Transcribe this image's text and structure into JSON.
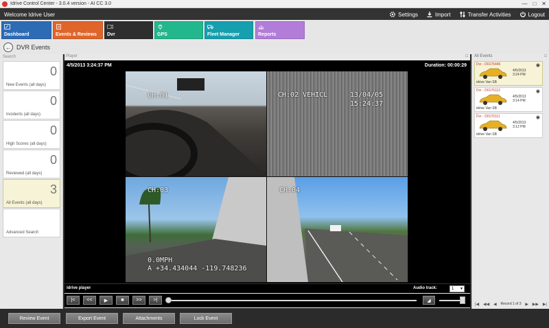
{
  "window": {
    "title": "Idrive Control Center - 3.0.4 version - AI CC 3.0"
  },
  "header": {
    "welcome": "Welcome Idrive User",
    "settings": "Settings",
    "import": "Import",
    "transfer": "Transfer Activities",
    "logout": "Logout"
  },
  "tabs": [
    {
      "label": "Dashboard",
      "color": "#2d6bb5"
    },
    {
      "label": "Events & Reviews",
      "color": "#e0652b"
    },
    {
      "label": "Dvr",
      "color": "#2e2e2e"
    },
    {
      "label": "GPS",
      "color": "#23b78e"
    },
    {
      "label": "Fleet Manager",
      "color": "#169fae"
    },
    {
      "label": "Reports",
      "color": "#b27cd9"
    }
  ],
  "page": {
    "title": "DVR Events"
  },
  "search": {
    "caption": "Search",
    "items": [
      {
        "value": "0",
        "label": "New Events (all days)"
      },
      {
        "value": "0",
        "label": "Incidents (all days)"
      },
      {
        "value": "0",
        "label": "High Scores (all days)"
      },
      {
        "value": "0",
        "label": "Reviewed (all days)"
      },
      {
        "value": "3",
        "label": "All Events (all days)"
      },
      {
        "value": "",
        "label": "Advanced Search"
      }
    ]
  },
  "player": {
    "caption": "Player",
    "timestamp": "4/5/2013 3:24:37 PM",
    "duration": "Duration: 00:00:29",
    "cams": {
      "ch1": "CH:01",
      "ch2": "CH:02 VEHICL",
      "ch2_date": "13/04/05",
      "ch2_time": "15:24:37",
      "ch3": "CH:03",
      "ch4": "CH:04",
      "speed": "0.0MPH",
      "coords": "A +34.434044 -119.748236"
    },
    "name": "idrive player",
    "audio_label": "Audio track:",
    "audio_value": "1"
  },
  "events": {
    "caption": "All Events",
    "items": [
      {
        "title": "Dvr - D0176446",
        "date": "4/5/2013",
        "time": "3:24 PM",
        "vehicle": "idrive Van SB"
      },
      {
        "title": "Dvr - D0176112",
        "date": "4/5/2013",
        "time": "3:14 PM",
        "vehicle": "idrive Van SB"
      },
      {
        "title": "Dvr - D0176111",
        "date": "4/5/2013",
        "time": "3:12 PM",
        "vehicle": "idrive Van SB"
      }
    ],
    "record": "Record 1 of 3"
  },
  "footer": {
    "review": "Review Event",
    "export": "Export Event",
    "attachments": "Attachments",
    "lock": "Lock Event"
  }
}
